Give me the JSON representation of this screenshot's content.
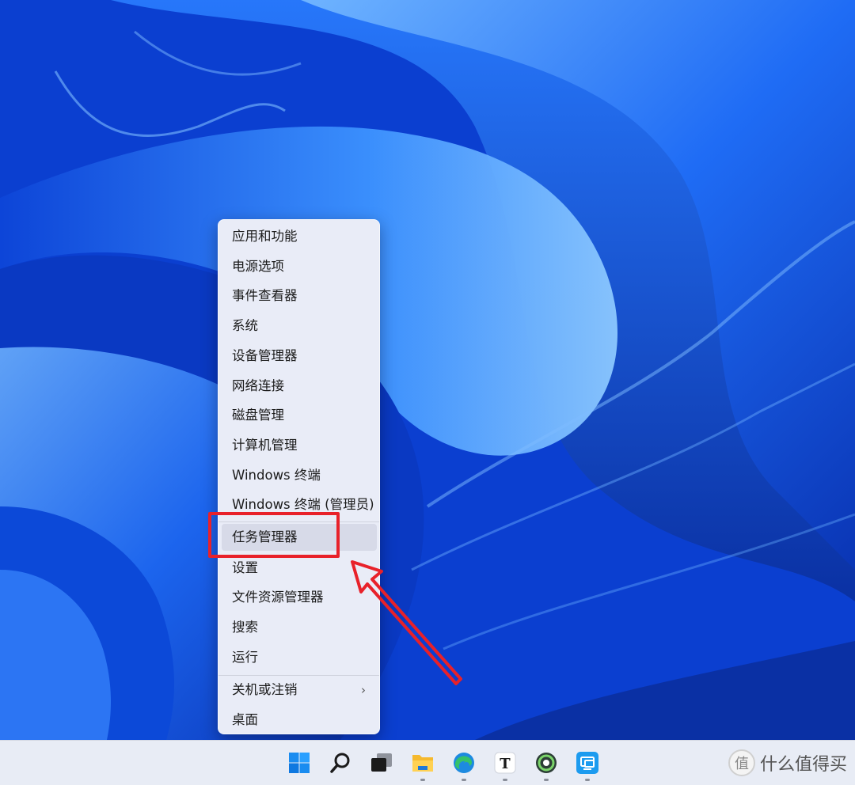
{
  "context_menu": {
    "items": [
      {
        "label": "应用和功能"
      },
      {
        "label": "电源选项"
      },
      {
        "label": "事件查看器"
      },
      {
        "label": "系统"
      },
      {
        "label": "设备管理器"
      },
      {
        "label": "网络连接"
      },
      {
        "label": "磁盘管理"
      },
      {
        "label": "计算机管理"
      },
      {
        "label": "Windows 终端"
      },
      {
        "label": "Windows 终端 (管理员)"
      },
      {
        "label": "任务管理器",
        "highlighted": true
      },
      {
        "label": "设置"
      },
      {
        "label": "文件资源管理器"
      },
      {
        "label": "搜索"
      },
      {
        "label": "运行"
      },
      {
        "label": "关机或注销",
        "has_submenu": true
      },
      {
        "label": "桌面"
      }
    ]
  },
  "taskbar": {
    "icons": [
      "windows-start-icon",
      "search-icon",
      "task-view-icon",
      "file-explorer-icon",
      "edge-icon",
      "typora-icon",
      "camtasia-icon",
      "remote-desktop-icon"
    ]
  },
  "watermark": {
    "text": "什么值得买",
    "logo_glyph": "值"
  },
  "colors": {
    "annotation": "#e8212a",
    "menu_bg": "#e9ecf7",
    "taskbar_bg": "#e8ecf5"
  }
}
